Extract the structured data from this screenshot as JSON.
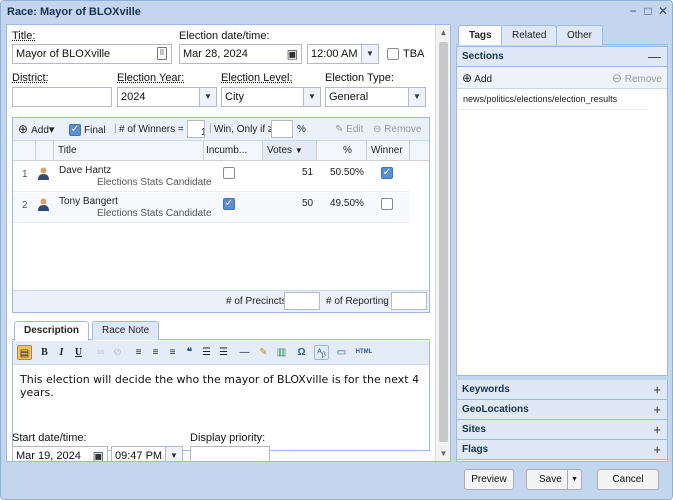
{
  "window": {
    "title": "Race: Mayor of BLOXville",
    "minimize": "−",
    "restore": "□",
    "close": "✕"
  },
  "form": {
    "title_label": "Title:",
    "title_value": "Mayor of BLOXville",
    "election_dt_label": "Election date/time:",
    "election_date": "Mar 28, 2024",
    "election_time": "12:00 AM",
    "tba_label": "TBA",
    "district_label": "District:",
    "district_value": "",
    "year_label": "Election Year:",
    "year_value": "2024",
    "level_label": "Election Level:",
    "level_value": "City",
    "type_label": "Election Type:",
    "type_value": "General"
  },
  "grid": {
    "add_label": "Add",
    "final_label": "Final",
    "winners_label": "# of Winners =",
    "winners_value": "1",
    "win_only_label": "Win, Only if ≥",
    "win_only_value": "",
    "percent_sign": "%",
    "edit_label": "Edit",
    "remove_label": "Remove",
    "final_checked": true,
    "columns": [
      "Title",
      "Incumb...",
      "Votes",
      "%",
      "Winner"
    ],
    "rows": [
      {
        "num": "1",
        "name": "Dave Hantz",
        "sub": "Elections Stats Candidate",
        "incumbent": false,
        "votes": "51",
        "percent": "50.50%",
        "winner": true
      },
      {
        "num": "2",
        "name": "Tony Bangert",
        "sub": "Elections Stats Candidate",
        "incumbent": true,
        "votes": "50",
        "percent": "49.50%",
        "winner": false
      }
    ],
    "precincts_label": "# of Precincts",
    "precincts_value": "",
    "reporting_label": "# of Reporting",
    "reporting_value": ""
  },
  "desc_tabs": [
    "Description",
    "Race Note"
  ],
  "editor": {
    "text": "This election will decide the who the mayor of BLOXville is for the next 4 years."
  },
  "bottom": {
    "start_label": "Start date/time:",
    "start_date": "Mar 19, 2024",
    "start_time": "09:47 PM",
    "priority_label": "Display priority:",
    "priority_value": ""
  },
  "right": {
    "tabs": [
      "Tags",
      "Related",
      "Other"
    ],
    "sections_title": "Sections",
    "add_label": "Add",
    "remove_label": "Remove",
    "section_item": "news/politics/elections/election_results",
    "collapsed": [
      "Keywords",
      "GeoLocations",
      "Sites",
      "Flags"
    ]
  },
  "buttons": {
    "preview": "Preview",
    "save": "Save",
    "cancel": "Cancel"
  },
  "colors": {
    "accent": "#99bbe8",
    "header": "#dfe8f6",
    "window": "#c3d6ee"
  }
}
